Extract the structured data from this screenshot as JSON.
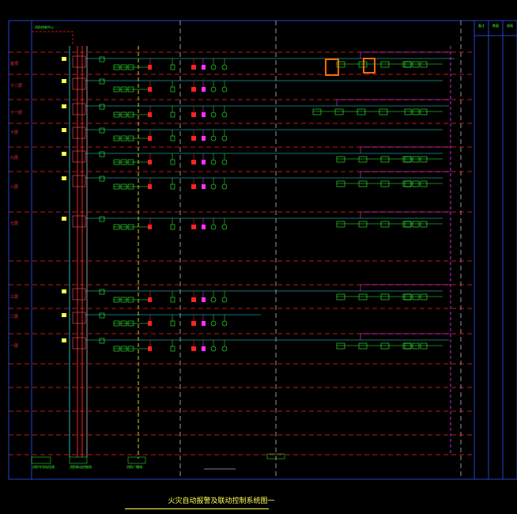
{
  "title": "火灾自动报警及联动控制系统图一",
  "floors": [
    {
      "label": "屋顶"
    },
    {
      "label": "十二层"
    },
    {
      "label": "十一层"
    },
    {
      "label": "十层"
    },
    {
      "label": "九层"
    },
    {
      "label": "八层"
    },
    {
      "label": "七层"
    },
    {
      "label": "三层"
    },
    {
      "label": "二层"
    },
    {
      "label": "一层"
    }
  ],
  "colors": {
    "background": "#000000",
    "frame": "#2244cc",
    "floor_line": "#ff2222",
    "cyan_bus": "#33dddd",
    "green_device": "#33ff33",
    "magenta_bus": "#ff33ff",
    "yellow_dash": "#ffff44",
    "highlight": "#ff6a00"
  },
  "right_columns": [
    "备注",
    "数量",
    "规格"
  ],
  "bottom_notes": [
    "消防专用电话线",
    "消防联动控制线",
    "消防广播线"
  ],
  "top_note": "消防控制中心"
}
